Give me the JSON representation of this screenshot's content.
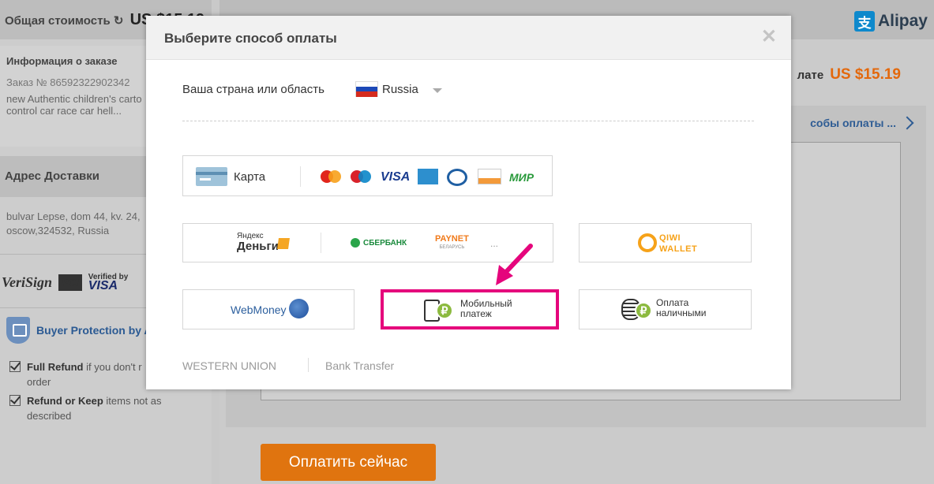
{
  "background": {
    "total_label": "Общая стоимость",
    "total_value": "US $15.19",
    "order": {
      "title": "Информация о заказе",
      "number_label": "Заказ №",
      "number": "86592322902342",
      "desc_line1": "new Authentic children's carto",
      "desc_line2": "control car race car hell..."
    },
    "address": {
      "title": "Адрес Доставки",
      "line1": "bulvar Lepse, dom 44, kv. 24,",
      "line2": "oscow,324532, Russia"
    },
    "trust": {
      "verisign": "VeriSign",
      "pci": "PCI",
      "vbv_top": "Verified by",
      "vbv_brand": "VISA"
    },
    "buyer_protection": "Buyer Protection by A",
    "guarantees": [
      {
        "bold": "Full Refund",
        "rest": " if you don't r",
        "line2": "order"
      },
      {
        "bold": "Refund or Keep",
        "rest": " items not as",
        "line2": "described"
      }
    ],
    "alipay_label": "Alipay",
    "pay_total_label": "лате",
    "pay_total_value": "US $15.19",
    "methods_link": "собы оплаты ...",
    "pay_now_button": "Оплатить сейчас"
  },
  "modal": {
    "title": "Выберите способ оплаты",
    "close": "✕",
    "country_label": "Ваша страна или область",
    "country_value": "Russia",
    "card": {
      "label": "Карта",
      "brands": [
        "mastercard",
        "maestro",
        "VISA",
        "AMERICAN EXPRESS",
        "Diners Club",
        "DISCOVER",
        "МИР"
      ]
    },
    "wallets": {
      "yandex_top": "Яндекс",
      "yandex_bottom": "Деньги",
      "sber": "СБЕРБАНК",
      "paynet": "PAYNET",
      "paynet_sub": "БЕЛАРУСЬ",
      "more": "..."
    },
    "qiwi": {
      "line1": "QIWI",
      "line2": "WALLET"
    },
    "webmoney": "WebMoney",
    "mobile": {
      "label": "Мобильный платеж"
    },
    "cash": {
      "line1": "Оплата",
      "line2": "наличными"
    },
    "western_union": "WESTERN UNION",
    "bank_transfer": "Bank Transfer"
  },
  "colors": {
    "accent_orange": "#e3680c",
    "highlight_pink": "#e5057c",
    "link_blue": "#2e5c94"
  }
}
